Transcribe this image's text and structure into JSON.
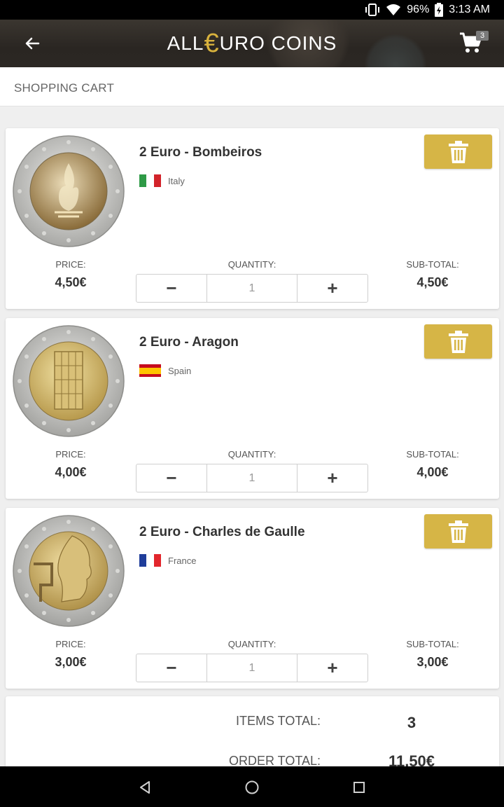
{
  "status_bar": {
    "battery": "96%",
    "time": "3:13 AM"
  },
  "app_bar": {
    "brand_prefix": "ALL",
    "brand_euro": "€",
    "brand_suffix": "URO COINS",
    "cart_count": "3"
  },
  "page_title": "SHOPPING CART",
  "labels": {
    "price": "PRICE:",
    "quantity": "QUANTITY:",
    "subtotal": "SUB-TOTAL:",
    "minus": "−",
    "plus": "+"
  },
  "cart_items": [
    {
      "title": "2 Euro - Bombeiros",
      "country": "Italy",
      "flag_colors": [
        "#2e9a46",
        "#ffffff",
        "#d2232a"
      ],
      "price": "4,50€",
      "quantity": "1",
      "subtotal": "4,50€"
    },
    {
      "title": "2 Euro - Aragon",
      "country": "Spain",
      "flag_colors": [
        "#c60b1e",
        "#ffc400",
        "#c60b1e"
      ],
      "price": "4,00€",
      "quantity": "1",
      "subtotal": "4,00€"
    },
    {
      "title": "2 Euro - Charles de Gaulle",
      "country": "France",
      "flag_colors": [
        "#1f3d9a",
        "#ffffff",
        "#e2262c"
      ],
      "price": "3,00€",
      "quantity": "1",
      "subtotal": "3,00€"
    }
  ],
  "totals": {
    "items_label": "ITEMS TOTAL:",
    "items_value": "3",
    "order_label": "ORDER TOTAL:",
    "order_value": "11,50€"
  },
  "colors": {
    "accent": "#d6b546",
    "app_bar": "#2c2824"
  }
}
